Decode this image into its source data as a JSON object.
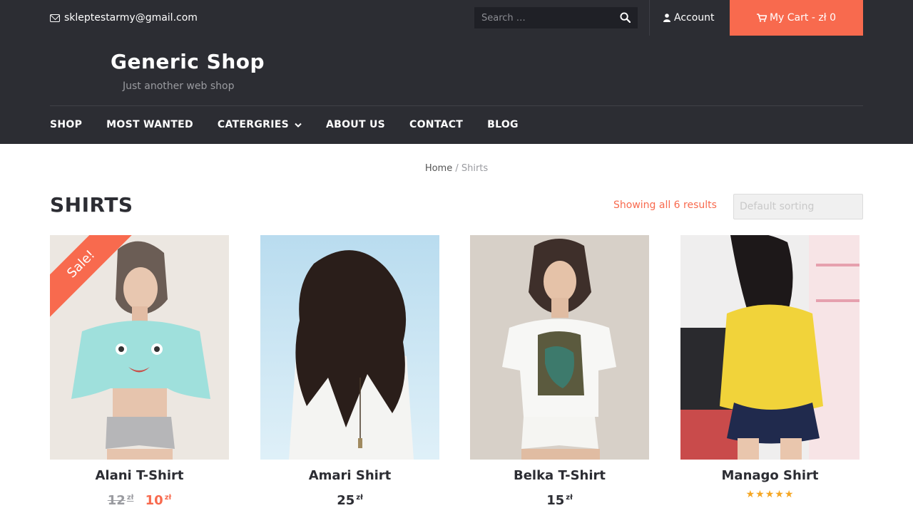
{
  "topbar": {
    "email": "skleptestarmy@gmail.com",
    "search_placeholder": "Search …",
    "account_label": "Account",
    "cart_label": "My Cart - zł 0"
  },
  "header": {
    "site_title": "Generic Shop",
    "tagline": "Just another web shop"
  },
  "nav": {
    "items": [
      "SHOP",
      "MOST WANTED",
      "CATERGRIES",
      "ABOUT US",
      "CONTACT",
      "BLOG"
    ]
  },
  "breadcrumb": {
    "home": "Home",
    "separator": " / ",
    "current": "Shirts"
  },
  "page": {
    "title": "SHIRTS",
    "results": "Showing all 6 results",
    "sorting_selected": "Default sorting"
  },
  "products": [
    {
      "name": "Alani T-Shirt",
      "old_price": "12",
      "price": "10",
      "currency": "zł",
      "sale_label": "Sale!"
    },
    {
      "name": "Amari Shirt",
      "price": "25",
      "currency": "zł"
    },
    {
      "name": "Belka T-Shirt",
      "price": "15",
      "currency": "zł"
    },
    {
      "name": "Manago Shirt",
      "stars": "★★★★★",
      "rating": 5
    }
  ],
  "colors": {
    "dark": "#2c2d33",
    "accent": "#f86a4e",
    "star": "#f5a623"
  }
}
